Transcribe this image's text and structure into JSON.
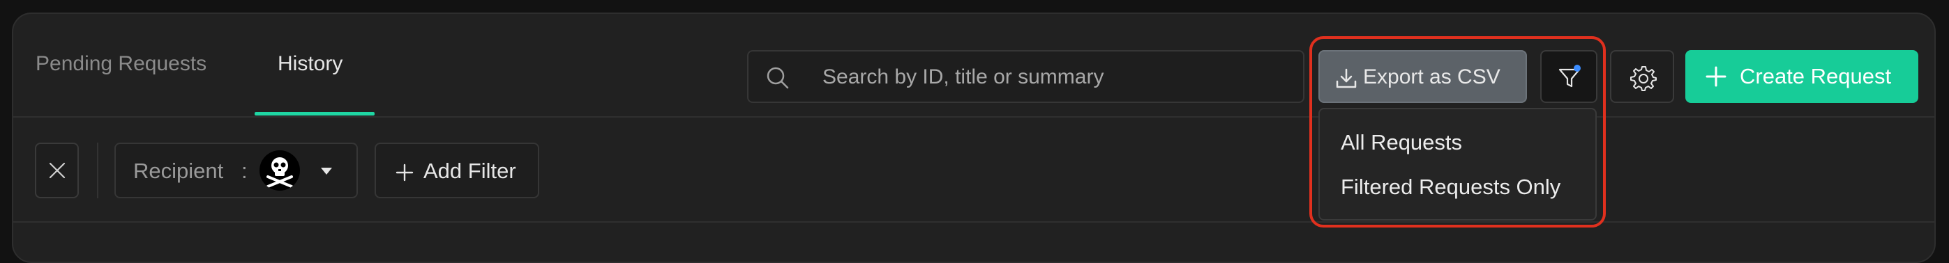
{
  "tabs": [
    {
      "label": "Pending Requests",
      "active": false
    },
    {
      "label": "History",
      "active": true
    }
  ],
  "search": {
    "placeholder": "Search by ID, title or summary",
    "icon": "search-icon"
  },
  "toolbar": {
    "export_label": "Export as CSV",
    "filter_icon": "filter-icon",
    "settings_icon": "gear-icon",
    "create_label": "Create Request"
  },
  "export_menu": {
    "items": [
      "All Requests",
      "Filtered Requests Only"
    ]
  },
  "filters": {
    "recipient_label": "Recipient",
    "separator": ":",
    "add_filter_label": "Add Filter",
    "avatar_icon": "skull-crossbones-icon"
  },
  "colors": {
    "accent": "#17cc98",
    "highlight": "#e0301e",
    "export_bg": "#5c6268",
    "filter_dot": "#3b8cff"
  }
}
